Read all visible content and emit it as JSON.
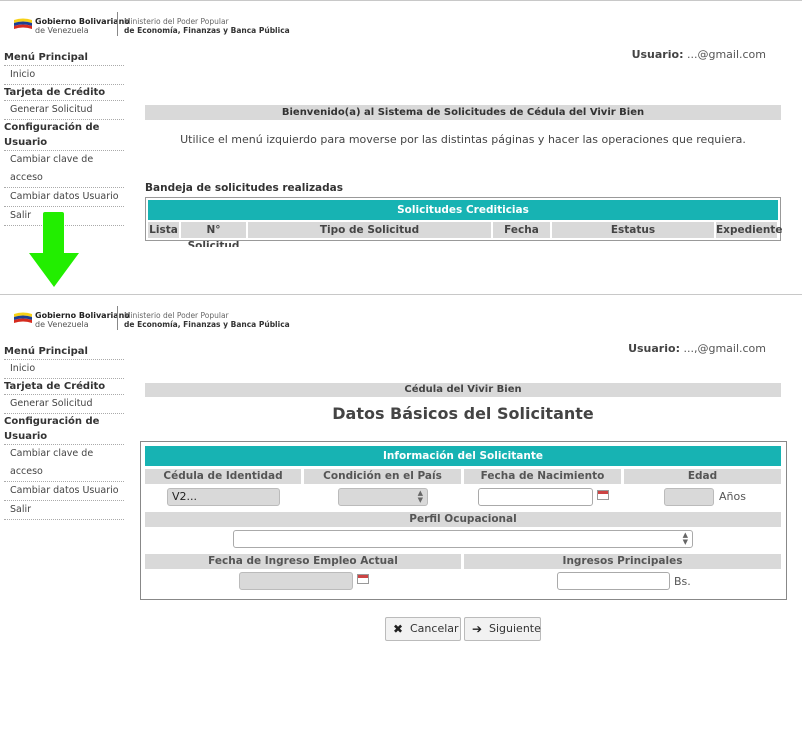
{
  "header": {
    "gov_line1": "Gobierno Bolivariano",
    "gov_line2": "de Venezuela",
    "ministry_line1": "Ministerio del Poder Popular",
    "ministry_line2": "de Economía, Finanzas y Banca Pública"
  },
  "user": {
    "label": "Usuario:",
    "email_top": "...@gmail.com",
    "email_bottom": "...,@gmail.com"
  },
  "sidebar": {
    "menu_principal": "Menú Principal",
    "inicio": "Inicio",
    "tarjeta": "Tarjeta de Crédito",
    "generar": "Generar Solicitud",
    "config_line1": "Configuración de",
    "config_line2": "Usuario",
    "cambiar_clave": "Cambiar clave de acceso",
    "cambiar_datos": "Cambiar datos Usuario",
    "salir": "Salir"
  },
  "home": {
    "welcome": "Bienvenido(a) al Sistema de Solicitudes de Cédula del Vivir Bien",
    "instructions": "Utilice el menú izquierdo para moverse por las distintas páginas y hacer las operaciones que requiera.",
    "bandeja": "Bandeja de solicitudes realizadas",
    "table_title": "Solicitudes Crediticias",
    "columns": [
      "Lista",
      "N° Solicitud",
      "Tipo de Solicitud",
      "Fecha",
      "Estatus",
      "Expediente"
    ]
  },
  "form": {
    "section": "Cédula del Vivir Bien",
    "title": "Datos Básicos del Solicitante",
    "box_title": "Información del Solicitante",
    "lbl_cedula": "Cédula de Identidad",
    "lbl_condicion": "Condición en el País",
    "lbl_fecha_nac": "Fecha de Nacimiento",
    "lbl_edad": "Edad",
    "cedula_value": "V2...",
    "unit_edad": "Años",
    "lbl_perfil": "Perfil Ocupacional",
    "lbl_fecha_ingreso": "Fecha de Ingreso Empleo Actual",
    "lbl_ingresos": "Ingresos Principales",
    "unit_ingresos": "Bs.",
    "cancel": "Cancelar",
    "next": "Siguiente"
  },
  "colors": {
    "accent_teal": "#17b3b3",
    "label_gray": "#d9d9d9",
    "arrow_green": "#22ee00"
  }
}
